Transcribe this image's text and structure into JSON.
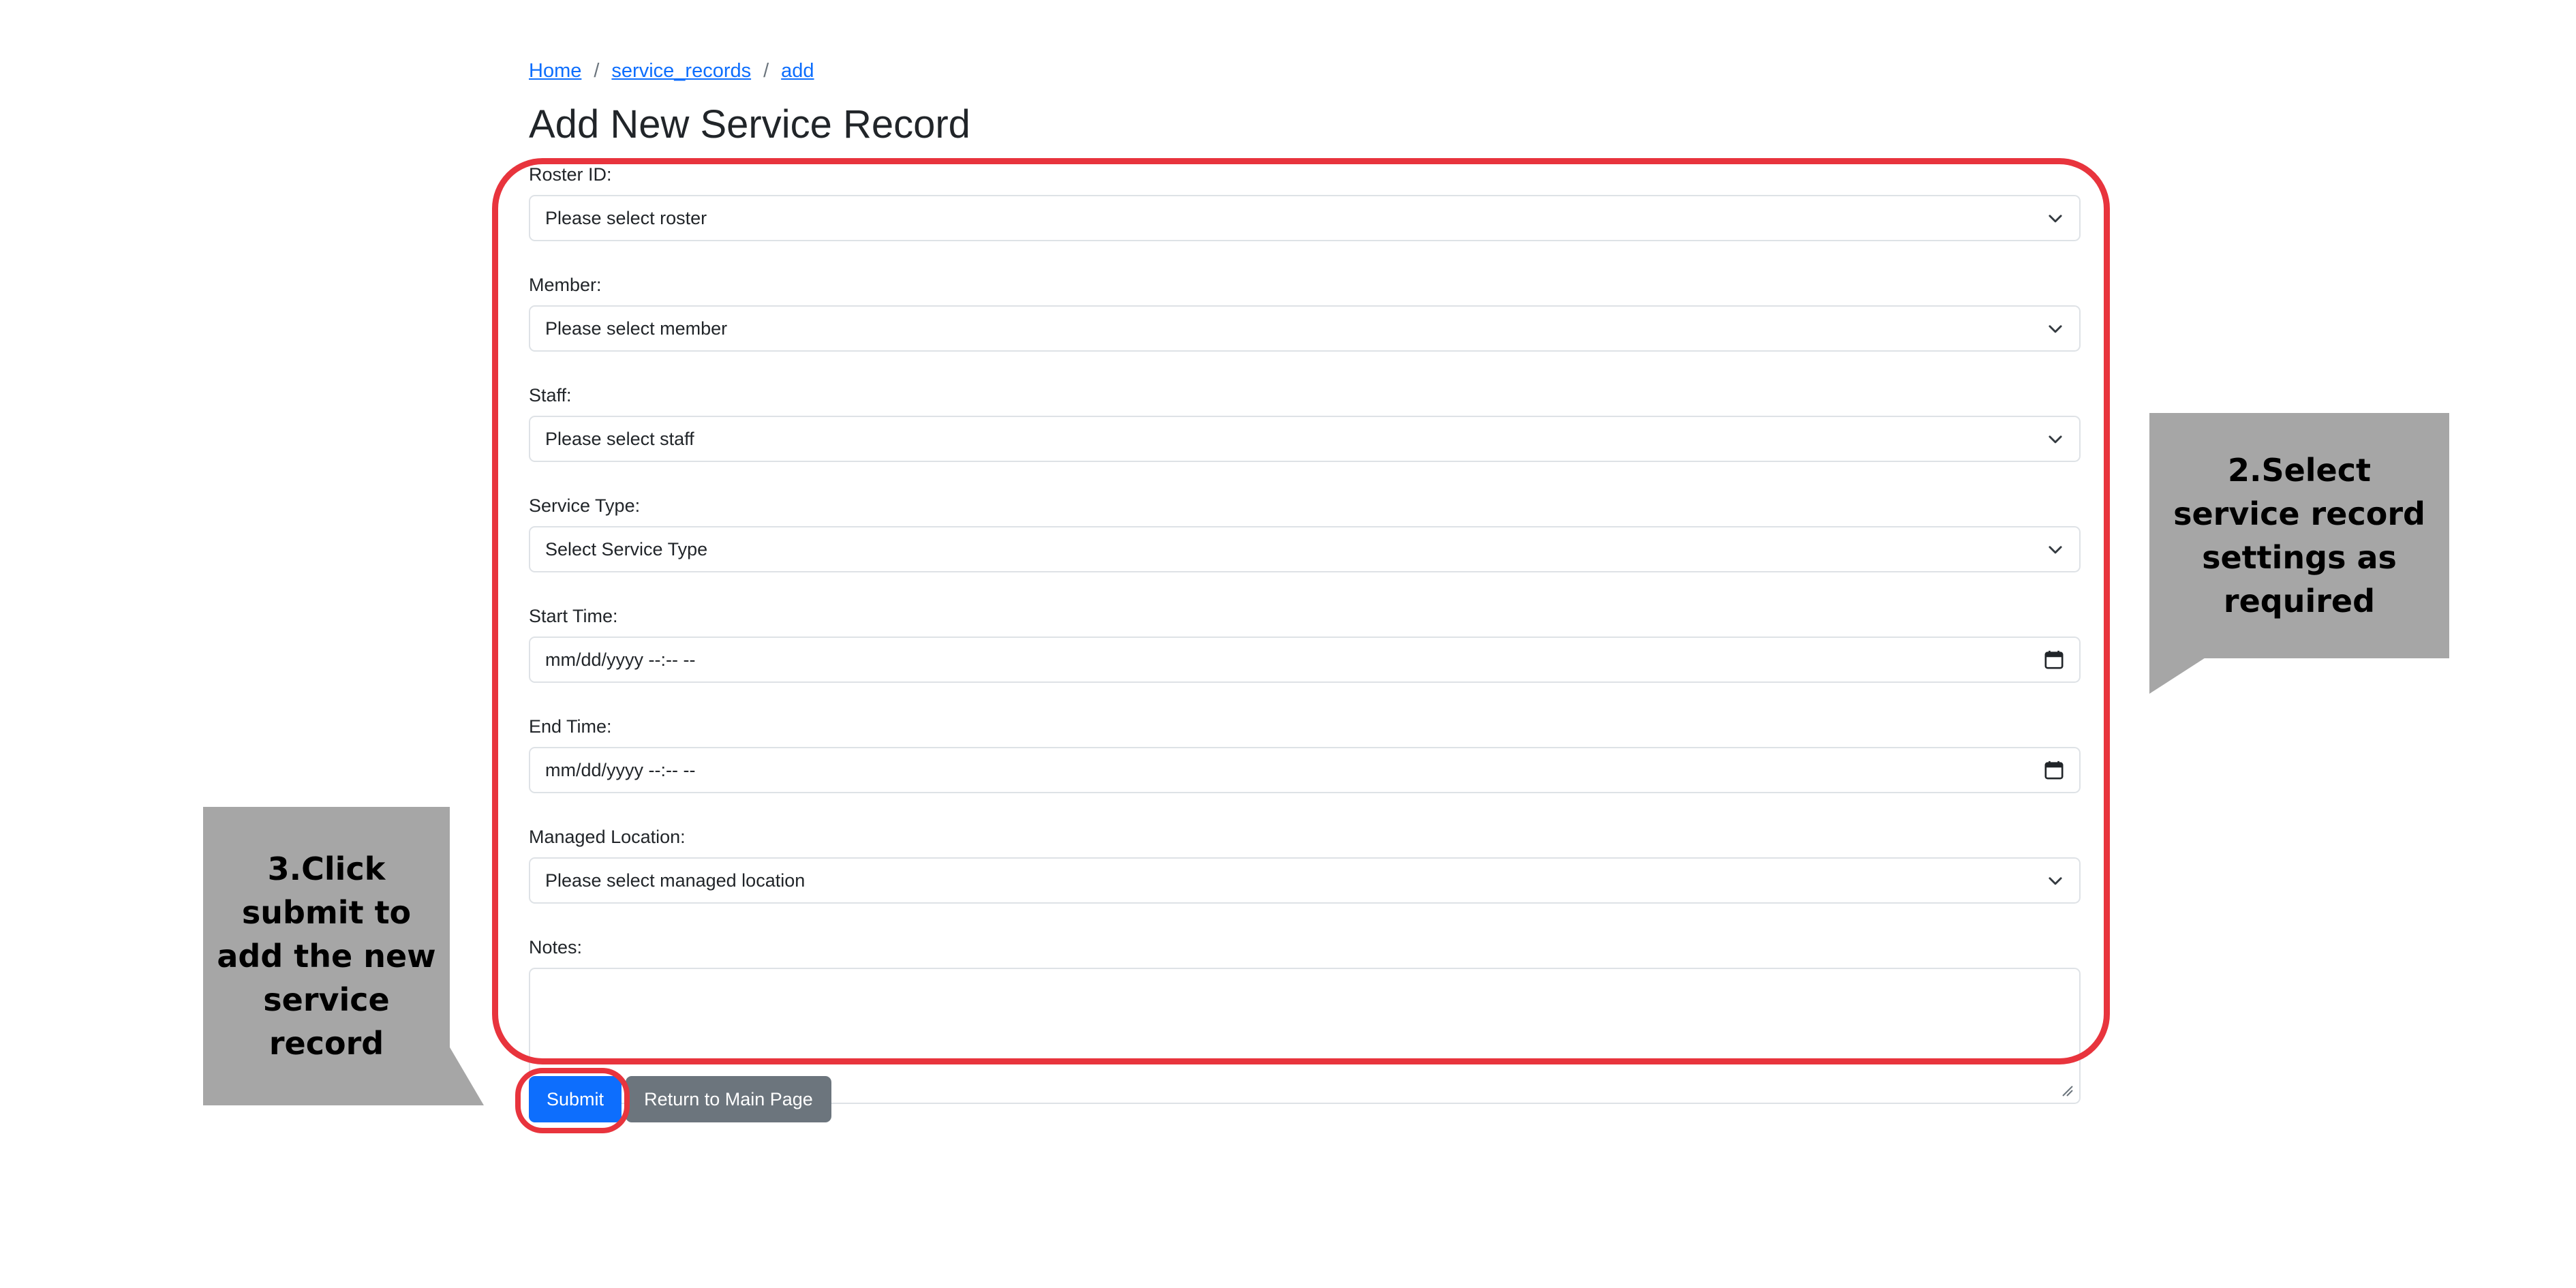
{
  "breadcrumb": {
    "items": [
      "Home",
      "service_records",
      "add"
    ],
    "separator": "/"
  },
  "page": {
    "title": "Add New Service Record"
  },
  "form": {
    "roster_label": "Roster ID:",
    "roster_value": "Please select roster",
    "member_label": "Member:",
    "member_value": "Please select member",
    "staff_label": "Staff:",
    "staff_value": "Please select staff",
    "service_type_label": "Service Type:",
    "service_type_value": "Select Service Type",
    "start_time_label": "Start Time:",
    "start_time_value": "mm/dd/yyyy --:-- --",
    "end_time_label": "End Time:",
    "end_time_value": "mm/dd/yyyy --:-- --",
    "location_label": "Managed Location:",
    "location_value": "Please select managed location",
    "notes_label": "Notes:",
    "notes_value": ""
  },
  "actions": {
    "submit_label": "Submit",
    "return_label": "Return to Main Page"
  },
  "annotations": {
    "step2": "2.Select service record settings as required",
    "step3": "3.Click submit to add the new service record"
  },
  "colors": {
    "highlight": "#e8343d",
    "callout_bg": "#a6a6a6",
    "primary": "#0d6efd",
    "secondary": "#6c757d",
    "link": "#0d6efd"
  },
  "icons": {
    "select": "chevron-down-icon",
    "datetime": "calendar-icon",
    "textarea_resize": "resize-grip-icon"
  }
}
